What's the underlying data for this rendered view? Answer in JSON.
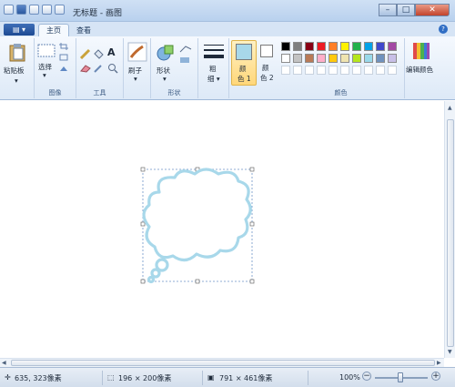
{
  "window": {
    "title": "无标题 - 画图"
  },
  "tabs": {
    "file": "▤ ▾",
    "home": "主页",
    "view": "查看"
  },
  "ribbon": {
    "clipboard": {
      "paste_label": "粘贴板",
      "group_label": ""
    },
    "image": {
      "select_label": "选择",
      "group_label": "图像"
    },
    "tools": {
      "group_label": "工具",
      "text_tool": "A"
    },
    "brushes": {
      "label": "刷子"
    },
    "shapes": {
      "label": "形状",
      "group_label": "形状"
    },
    "size": {
      "label_line1": "粗",
      "label_line2": "细 ▾"
    },
    "color1": {
      "line1": "颜",
      "line2": "色 1",
      "color": "#a8d8ea"
    },
    "color2": {
      "line1": "颜",
      "line2": "色 2",
      "color": "#ffffff"
    },
    "colors": {
      "group_label": "颜色",
      "edit_label": "编辑颜色",
      "palette_row1": [
        "#000000",
        "#7f7f7f",
        "#880015",
        "#ed1c24",
        "#ff7f27",
        "#fff200",
        "#22b14c",
        "#00a2e8",
        "#3f48cc",
        "#a349a4"
      ],
      "palette_row2": [
        "#ffffff",
        "#c3c3c3",
        "#b97a57",
        "#ffaec9",
        "#ffc90e",
        "#efe4b0",
        "#b5e61d",
        "#99d9ea",
        "#7092be",
        "#c8bfe7"
      ]
    }
  },
  "status": {
    "cursor_pos": "635, 323像素",
    "selection_size": "196 × 200像素",
    "canvas_size": "791 × 461像素",
    "zoom": "100%"
  },
  "shape": {
    "stroke_color": "#a8d8ea"
  }
}
